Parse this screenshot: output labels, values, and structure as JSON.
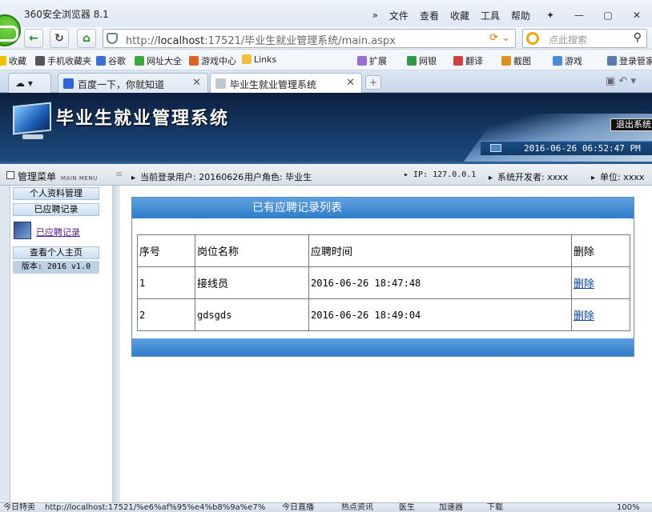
{
  "browser": {
    "app_title": "360安全浏览器 8.1",
    "menu": [
      "文件",
      "查看",
      "收藏",
      "工具",
      "帮助"
    ],
    "window_buttons": [
      "✦",
      "—",
      "▢",
      "✕"
    ],
    "url_prefix": "http://",
    "url_host": "localhost",
    "url_rest": ":17521/毕业生就业管理系统/main.aspx",
    "search_placeholder": "点此搜索",
    "favorites": [
      {
        "label": "收藏",
        "color": "#f2c200"
      },
      {
        "label": "手机收藏夹",
        "color": "#555555"
      },
      {
        "label": "谷歌",
        "color": "#3a6fd8"
      },
      {
        "label": "网址大全",
        "color": "#3aa83a"
      },
      {
        "label": "游戏中心",
        "color": "#e06020"
      },
      {
        "label": "Links",
        "color": "#f0c040"
      },
      {
        "label": "扩展",
        "color": "#9a6fd0"
      },
      {
        "label": "网银",
        "color": "#2f9a4a"
      },
      {
        "label": "翻译",
        "color": "#d04040"
      },
      {
        "label": "截图",
        "color": "#e09020"
      },
      {
        "label": "游戏",
        "color": "#4a8ad8"
      },
      {
        "label": "登录管家",
        "color": "#5a7ab0"
      }
    ],
    "tabs": [
      {
        "label": "百度一下，你就知道",
        "active": false,
        "icon_color": "#2b64d8"
      },
      {
        "label": "毕业生就业管理系统",
        "active": true,
        "icon_color": "#c0c8d4"
      }
    ],
    "status": {
      "left": "今日特卖",
      "url": "http://localhost:17521/%e6%af%95%e4%b8%9a%e7%",
      "items": [
        "今日直播",
        "热点资讯",
        "医生",
        "加速器",
        "下载",
        "100%"
      ]
    }
  },
  "site": {
    "title": "毕业生就业管理系统",
    "logout": "退出系统",
    "datetime": "2016-06-26 06:52:47 PM",
    "menu_head": "管理菜单",
    "menu_head_en": "MAIN MENU",
    "info": {
      "user_label": "当前登录用户:",
      "user": "20160626",
      "role_label": "用户角色:",
      "role": "毕业生",
      "ip": "IP: 127.0.0.1",
      "developer": "系统开发者: xxxx",
      "unit": "单位: xxxx"
    }
  },
  "sidebar": {
    "items": [
      "个人资料管理",
      "已应聘记录",
      "查看个人主页"
    ],
    "active_link": "已应聘记录",
    "version": "版本: 2016 v1.0"
  },
  "records": {
    "title": "已有应聘记录列表",
    "columns": [
      "序号",
      "岗位名称",
      "应聘时间",
      "删除"
    ],
    "rows": [
      {
        "no": "1",
        "position": "接线员",
        "time": "2016-06-26 18:47:48",
        "action": "删除"
      },
      {
        "no": "2",
        "position": "gdsgds",
        "time": "2016-06-26 18:49:04",
        "action": "删除"
      }
    ]
  }
}
